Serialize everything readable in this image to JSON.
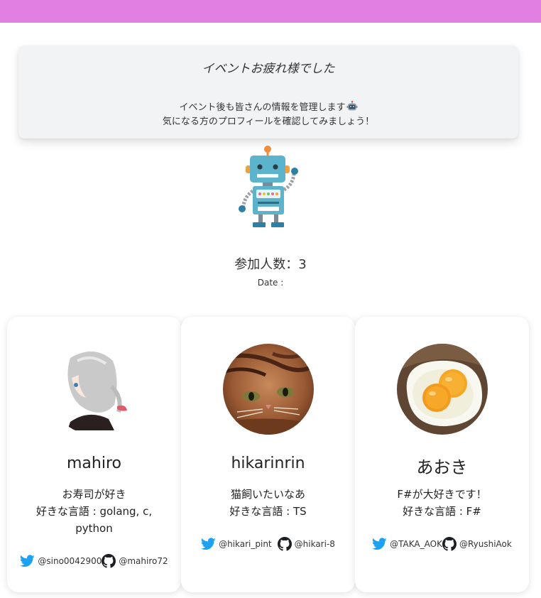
{
  "banner": {
    "title": "イベントお疲れ様でした",
    "line1": "イベント後も皆さんの情報を管理します",
    "line2": "気になる方のプロフィールを確認してみましょう！"
  },
  "event": {
    "participants": "参加人数：3",
    "date": "Date :"
  },
  "icons": {
    "header_emoji": "robot-face-icon",
    "illustration": "robot-illustration",
    "twitter": "twitter-icon",
    "github": "github-icon"
  },
  "colors": {
    "topbar": "#e27fe3",
    "twitter": "#1da1f2",
    "github": "#1b1f23"
  },
  "members": [
    {
      "name": "mahiro",
      "bio": "お寿司が好き",
      "languages": "好きな言語 : golang, c, python",
      "twitter": "@sino0042900",
      "github": "@mahiro72"
    },
    {
      "name": "hikarinrin",
      "bio": "猫飼いたいなあ",
      "languages": "好きな言語 : TS",
      "twitter": "@hikari_pint",
      "github": "@hikari-8"
    },
    {
      "name": "あおき",
      "bio": "F#が大好きです！",
      "languages": "好きな言語 : F#",
      "twitter": "@TAKA_AOK",
      "github": "@RyushiAok"
    }
  ]
}
